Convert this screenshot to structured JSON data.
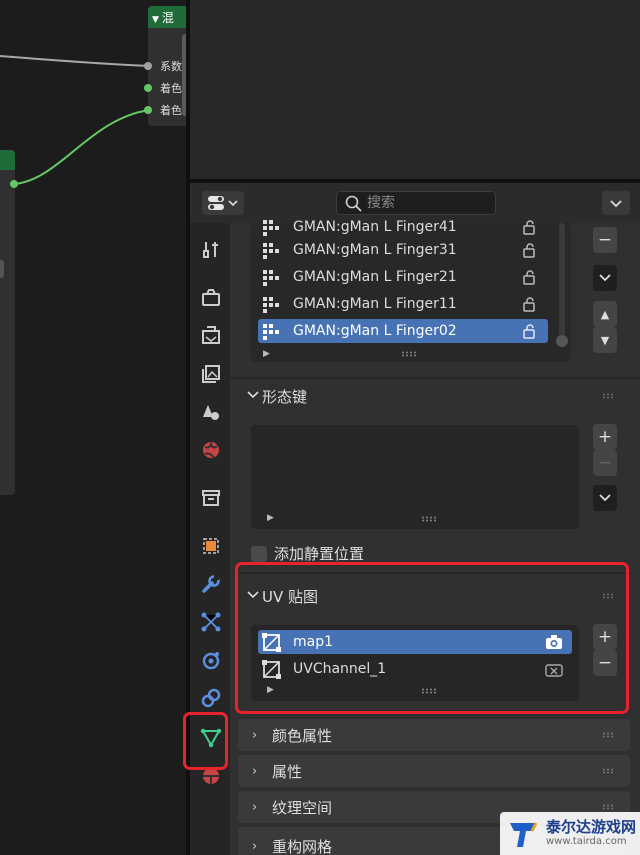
{
  "node_editor": {
    "mix_node": {
      "title": "混",
      "inputs": [
        "系数",
        "着色器",
        "着色器"
      ]
    }
  },
  "header": {
    "search_placeholder": "搜索"
  },
  "vertex_groups": {
    "items": [
      {
        "name": "GMAN:gMan L Finger41",
        "selected": false
      },
      {
        "name": "GMAN:gMan L Finger31",
        "selected": false
      },
      {
        "name": "GMAN:gMan L Finger21",
        "selected": false
      },
      {
        "name": "GMAN:gMan L Finger11",
        "selected": false
      },
      {
        "name": "GMAN:gMan L Finger02",
        "selected": true
      }
    ]
  },
  "shape_keys": {
    "title": "形态键",
    "add_rest_position_label": "添加静置位置"
  },
  "uv_maps": {
    "title": "UV 贴图",
    "items": [
      {
        "name": "map1",
        "active_render": true
      },
      {
        "name": "UVChannel_1",
        "active_render": false
      }
    ]
  },
  "collapsed_panels": {
    "color_attributes": "颜色属性",
    "attributes": "属性",
    "texture_space": "纹理空间",
    "remesh": "重构网格"
  },
  "watermark": {
    "title": "泰尔达游戏网",
    "url": "www.tairda.com"
  },
  "colors": {
    "accent": "#4772b3",
    "highlight": "#e8232d",
    "node_header": "#1f6b3a",
    "socket_gray": "#a1a1a1",
    "socket_green": "#63c763",
    "data_tab": "#3fd08f"
  }
}
